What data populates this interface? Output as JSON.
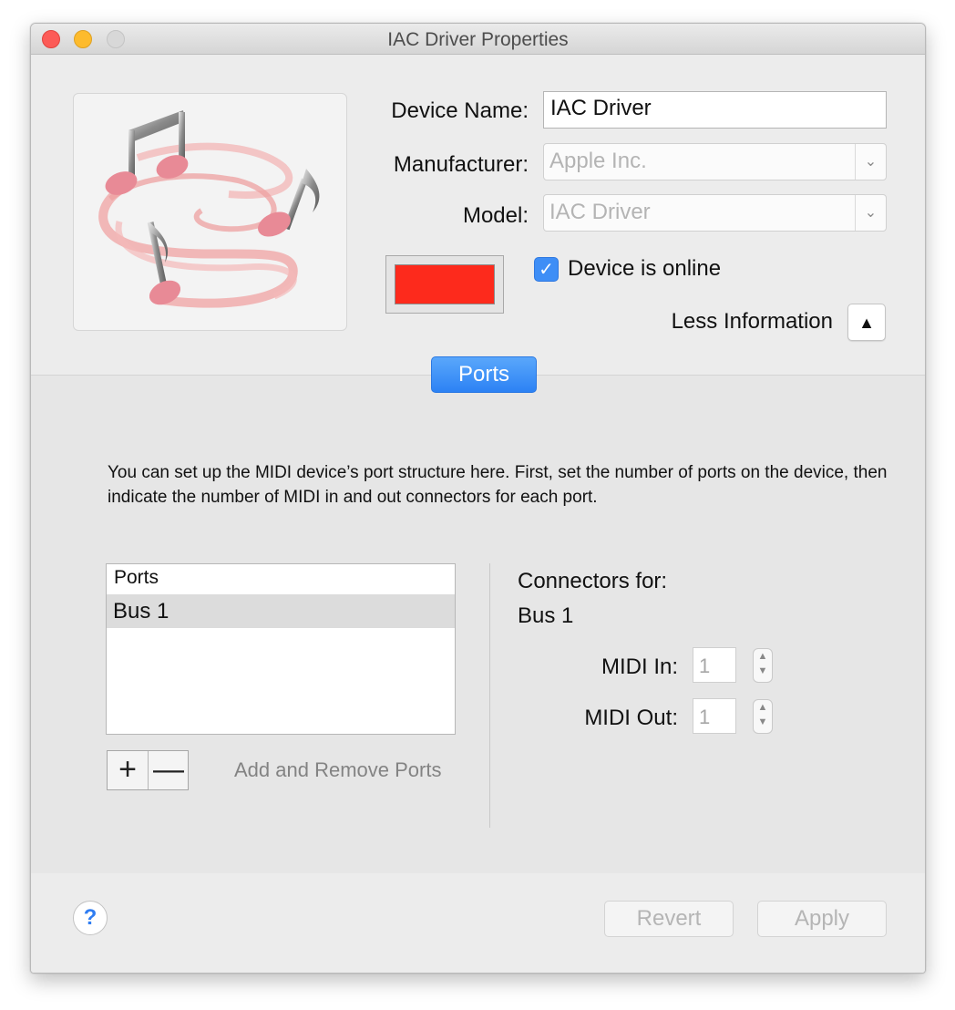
{
  "window": {
    "title": "IAC Driver Properties"
  },
  "device": {
    "name_label": "Device Name:",
    "name_value": "IAC Driver",
    "manufacturer_label": "Manufacturer:",
    "manufacturer_value": "Apple Inc.",
    "model_label": "Model:",
    "model_value": "IAC Driver",
    "color": "#fd2a1c",
    "online_label": "Device is online",
    "online_checked": true,
    "less_info_label": "Less Information"
  },
  "tabs": {
    "ports_label": "Ports"
  },
  "ports": {
    "description": "You can set up the MIDI device’s port structure here.  First, set the number of ports on the device, then indicate the number of MIDI in and out connectors for each port.",
    "list_header": "Ports",
    "items": [
      "Bus 1"
    ],
    "add_label": "+",
    "remove_label": "—",
    "add_remove_label": "Add and Remove Ports"
  },
  "connectors": {
    "heading": "Connectors for:",
    "bus_name": "Bus 1",
    "midi_in_label": "MIDI In:",
    "midi_in_value": "1",
    "midi_out_label": "MIDI Out:",
    "midi_out_value": "1"
  },
  "footer": {
    "help_label": "?",
    "revert_label": "Revert",
    "apply_label": "Apply"
  },
  "icons": {
    "up_triangle": "▲",
    "chevron_down": "⌄",
    "checkmark": "✓",
    "stepper_up": "▲",
    "stepper_down": "▼"
  }
}
